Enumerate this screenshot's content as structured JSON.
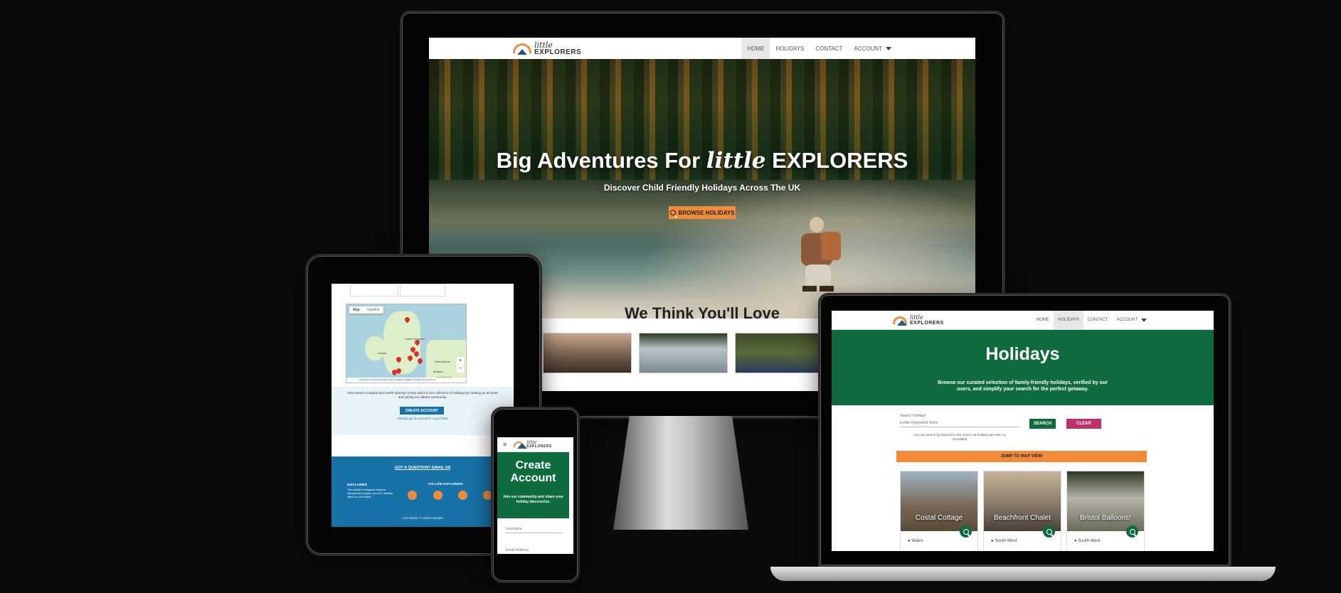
{
  "brand": {
    "little": "little",
    "explorers": "EXPLORERS"
  },
  "monitor": {
    "nav": [
      "HOME",
      "HOLIDAYS",
      "CONTACT",
      "ACCOUNT"
    ],
    "hero_title_start": "Big Adventures For",
    "hero_title_little": "little",
    "hero_title_end": "EXPLORERS",
    "hero_subtitle": "Discover Child Friendly Holidays Across The UK",
    "browse_button": "BROWSE HOLIDAYS",
    "section_title": "We Think You'll Love"
  },
  "laptop": {
    "nav": [
      "HOME",
      "HOLIDAYS",
      "CONTACT",
      "ACCOUNT"
    ],
    "page_title": "Holidays",
    "intro": "Browse our curated selection of family-friendly holidays, verified by our users, and simplify your search for the perfect getaway.",
    "search_label": "Search Holidays",
    "search_placeholder": "Enter Keyword here",
    "search_button": "SEARCH",
    "clear_button": "CLEAR",
    "search_help": "You can search by keyword in the recent UK holiday type title e.g Woodland",
    "map_button": "JUMP TO MAP VIEW",
    "cards": [
      {
        "title": "Costal Cottage",
        "location": "Wales"
      },
      {
        "title": "Beachfront Chalet",
        "location": "South-West"
      },
      {
        "title": "Bristol Balloons!",
        "location": "South-West"
      }
    ]
  },
  "tablet": {
    "map_tabs": [
      "Map",
      "Satellite"
    ],
    "map_labels": [
      "United Kingdom",
      "Ireland",
      "Netherlands",
      "Belgium",
      "Luxembourg"
    ],
    "map_footer": "Keyboard shortcuts   Map data ©2024 GeoBasis-DE/BKG (©2009), Google   Terms",
    "create_prompt": "Discovered a magical spot worth sharing? Easily add it to our collection of holidays by creating an account and joining our vibrant community.",
    "create_button": "CREATE ACCOUNT",
    "login_prompt": "Already got an account? Log in here",
    "question_link": "GOT A QUESTION? EMAIL US",
    "disclaimer_title": "DISCLAIMER",
    "disclaimer_text": "This website is designed solely for educational purposes. As such, holidays listed are not verified.",
    "follow_label": "FOLLOW",
    "follow_brand": "EXPLORERS",
    "copyright": "COPYRIGHT © KERRY ADAMS"
  },
  "phone": {
    "title": "Create Account",
    "subtitle": "Join our community and share your holiday discoveries.",
    "username_placeholder": "Username",
    "email_placeholder": "Email Address"
  }
}
